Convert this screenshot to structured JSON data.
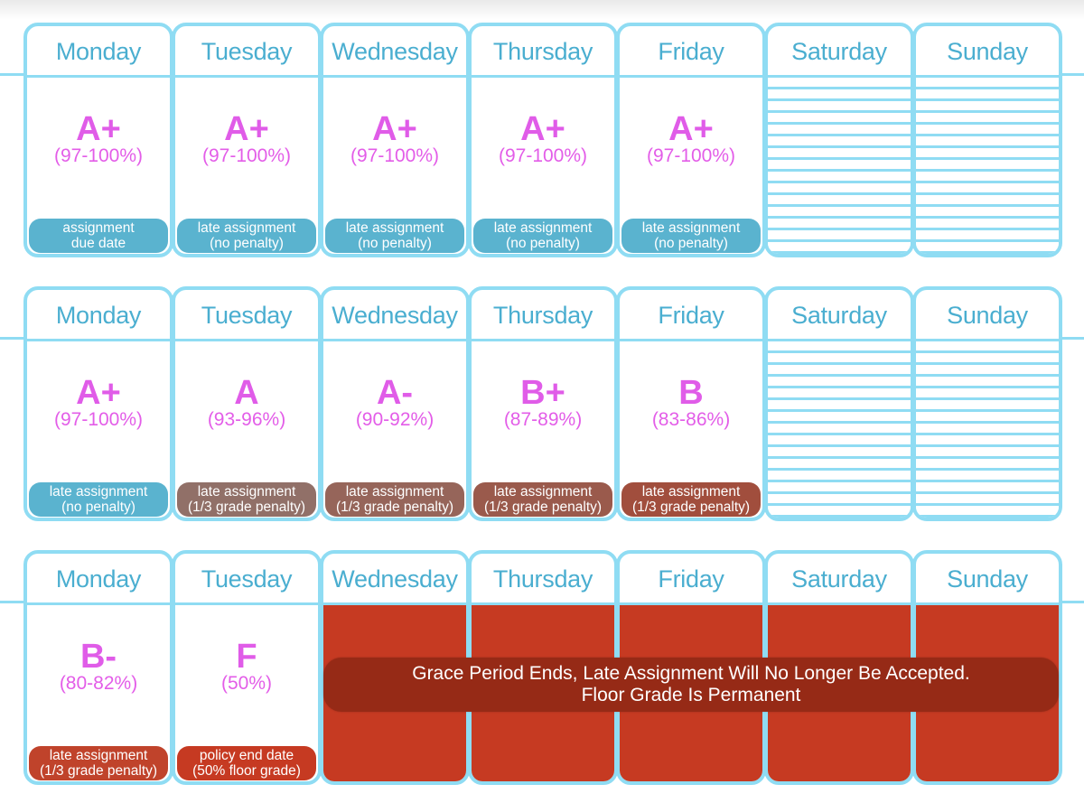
{
  "colors": {
    "border": "#8fdcf3",
    "day_label": "#4aaed0",
    "grade_text": "#e05ce8",
    "badge_no_penalty": "#5ab3cf",
    "badge_penalty_1": "#917068",
    "badge_penalty_2": "#96655a",
    "badge_penalty_3": "#9a5a4c",
    "badge_penalty_4": "#a14e3d",
    "badge_penalty_5": "#c0432b",
    "badge_policy_end": "#c63a22",
    "expired_fill": "#c63a22",
    "banner": "#962a16"
  },
  "weeks": [
    {
      "days": [
        {
          "label": "Monday",
          "grade": "A+",
          "range": "(97-100%)",
          "badge_line1": "assignment",
          "badge_line2": "due date",
          "badge_color": "#5ab3cf"
        },
        {
          "label": "Tuesday",
          "grade": "A+",
          "range": "(97-100%)",
          "badge_line1": "late assignment",
          "badge_line2": "(no penalty)",
          "badge_color": "#5ab3cf"
        },
        {
          "label": "Wednesday",
          "grade": "A+",
          "range": "(97-100%)",
          "badge_line1": "late assignment",
          "badge_line2": "(no penalty)",
          "badge_color": "#5ab3cf"
        },
        {
          "label": "Thursday",
          "grade": "A+",
          "range": "(97-100%)",
          "badge_line1": "late assignment",
          "badge_line2": "(no penalty)",
          "badge_color": "#5ab3cf"
        },
        {
          "label": "Friday",
          "grade": "A+",
          "range": "(97-100%)",
          "badge_line1": "late assignment",
          "badge_line2": "(no penalty)",
          "badge_color": "#5ab3cf"
        },
        {
          "label": "Saturday",
          "type": "weekend"
        },
        {
          "label": "Sunday",
          "type": "weekend"
        }
      ]
    },
    {
      "days": [
        {
          "label": "Monday",
          "grade": "A+",
          "range": "(97-100%)",
          "badge_line1": "late assignment",
          "badge_line2": "(no penalty)",
          "badge_color": "#5ab3cf"
        },
        {
          "label": "Tuesday",
          "grade": "A",
          "range": "(93-96%)",
          "badge_line1": "late assignment",
          "badge_line2": "(1/3 grade penalty)",
          "badge_color": "#917068"
        },
        {
          "label": "Wednesday",
          "grade": "A-",
          "range": "(90-92%)",
          "badge_line1": "late assignment",
          "badge_line2": "(1/3 grade penalty)",
          "badge_color": "#96655a"
        },
        {
          "label": "Thursday",
          "grade": "B+",
          "range": "(87-89%)",
          "badge_line1": "late assignment",
          "badge_line2": "(1/3 grade penalty)",
          "badge_color": "#9a5a4c"
        },
        {
          "label": "Friday",
          "grade": "B",
          "range": "(83-86%)",
          "badge_line1": "late assignment",
          "badge_line2": "(1/3 grade penalty)",
          "badge_color": "#a14e3d"
        },
        {
          "label": "Saturday",
          "type": "weekend"
        },
        {
          "label": "Sunday",
          "type": "weekend"
        }
      ]
    },
    {
      "days": [
        {
          "label": "Monday",
          "grade": "B-",
          "range": "(80-82%)",
          "badge_line1": "late assignment",
          "badge_line2": "(1/3 grade penalty)",
          "badge_color": "#c0432b"
        },
        {
          "label": "Tuesday",
          "grade": "F",
          "range": "(50%)",
          "badge_line1": "policy end date",
          "badge_line2": "(50% floor grade)",
          "badge_color": "#c63a22"
        },
        {
          "label": "Wednesday",
          "type": "expired"
        },
        {
          "label": "Thursday",
          "type": "expired"
        },
        {
          "label": "Friday",
          "type": "expired"
        },
        {
          "label": "Saturday",
          "type": "expired"
        },
        {
          "label": "Sunday",
          "type": "expired"
        }
      ]
    }
  ],
  "grace_banner": {
    "line1": "Grace Period Ends, Late Assignment Will No Longer Be Accepted.",
    "line2": "Floor Grade Is Permanent"
  }
}
